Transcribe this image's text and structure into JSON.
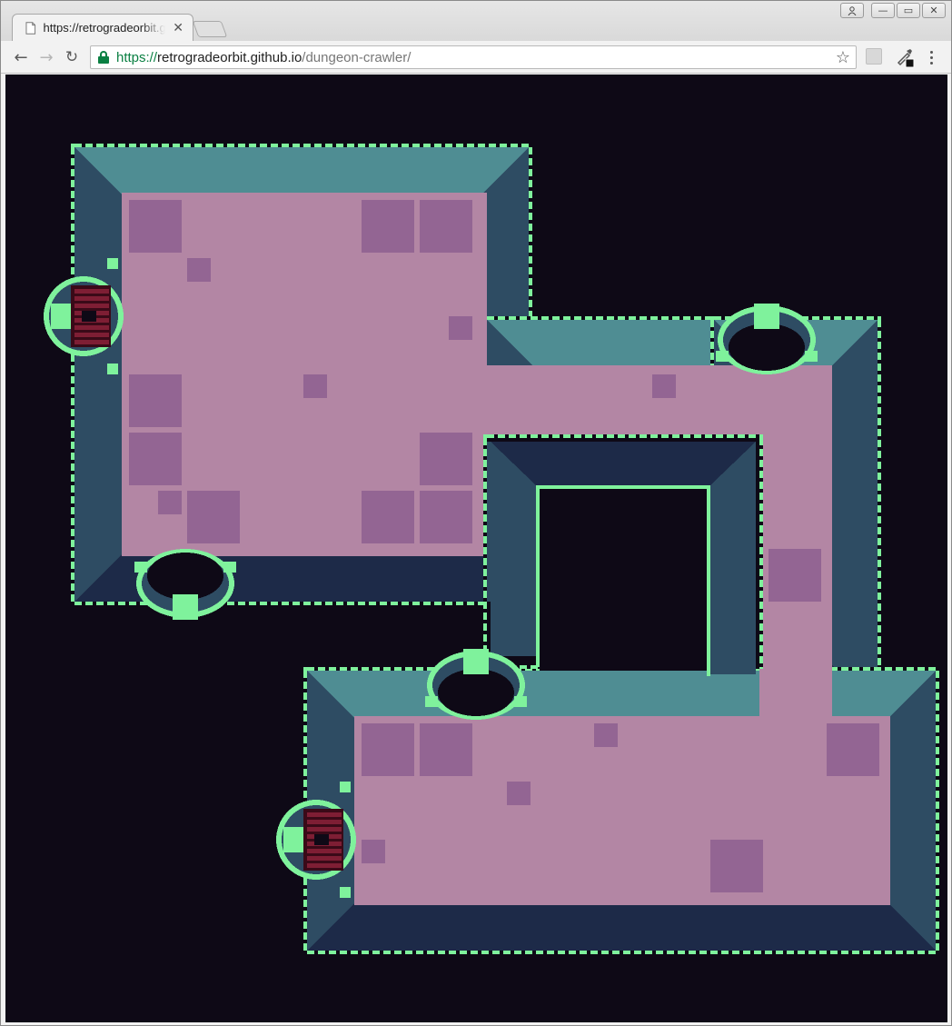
{
  "browser": {
    "tab": {
      "title": "https://retrogradeorbit.github.io/dungeon-crawler/"
    },
    "address_bar": {
      "scheme": "https://",
      "host": "retrogradeorbit.github.io",
      "path": "/dungeon-crawler/"
    },
    "icons": {
      "back": "back-arrow-icon",
      "forward": "forward-arrow-icon",
      "reload": "reload-icon",
      "secure": "lock-icon",
      "bookmark": "star-icon",
      "extension": "extension-icon",
      "picker": "eyedropper-icon",
      "menu": "kebab-menu-icon"
    }
  },
  "game": {
    "palette": {
      "background": "#0e0916",
      "floor": "#b386a4",
      "floor_tile": "#936593",
      "wall_top": "#4f8d93",
      "wall_side": "#2e4c63",
      "wall_bottom": "#1d2a48",
      "rim": "#7ff29c",
      "door": "#7e1e34",
      "door_dark": "#3a0a18"
    }
  }
}
